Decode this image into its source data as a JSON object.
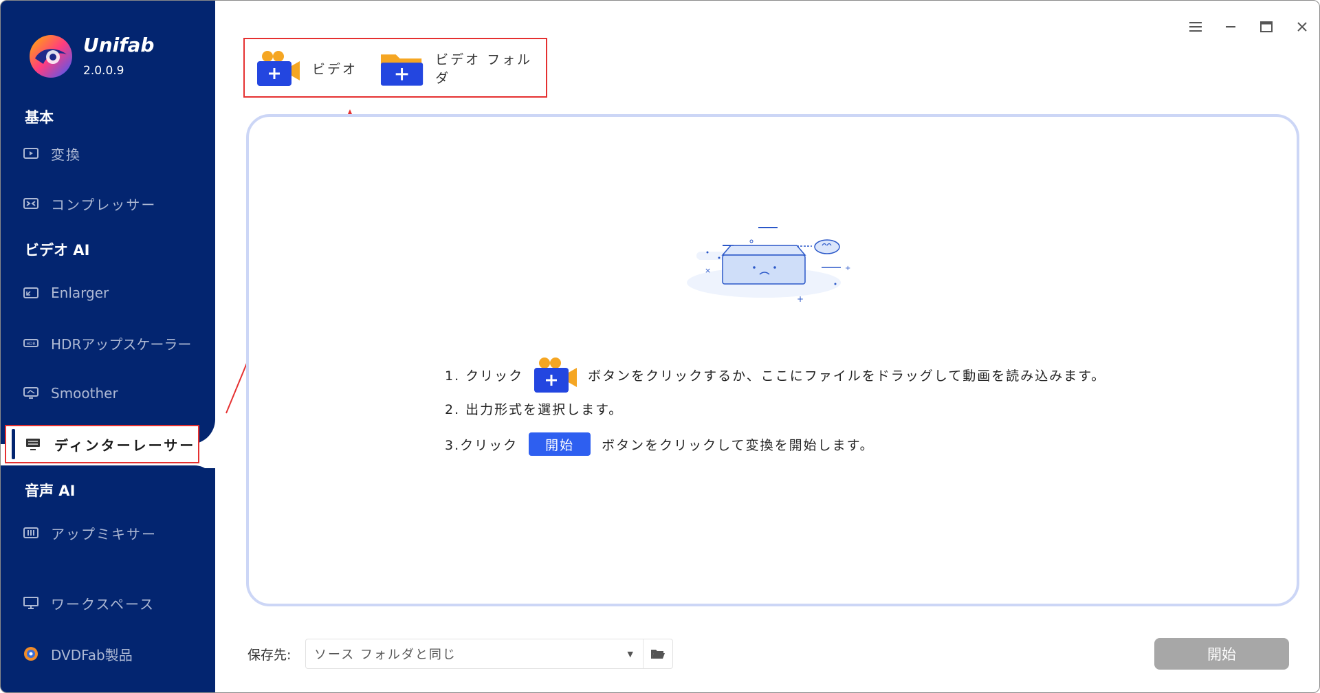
{
  "app": {
    "name": "Unifab",
    "version": "2.0.0.9"
  },
  "sidebar": {
    "sections": {
      "basic": "基本",
      "video_ai": "ビデオ AI",
      "audio_ai": "音声 AI"
    },
    "items": [
      {
        "label": "変換",
        "icon": "play-box-icon"
      },
      {
        "label": "コンプレッサー",
        "icon": "compress-icon"
      },
      {
        "label": "Enlarger",
        "icon": "enlarge-icon"
      },
      {
        "label": "HDRアップスケーラー",
        "icon": "hdr-icon"
      },
      {
        "label": "Smoother",
        "icon": "smoother-icon"
      },
      {
        "label": "ディンターレーサー",
        "icon": "deinterlacer-icon",
        "active": true
      },
      {
        "label": "アップミキサー",
        "icon": "upmixer-icon"
      },
      {
        "label": "ワークスペース",
        "icon": "monitor-icon"
      },
      {
        "label": "DVDFab製品",
        "icon": "dvdfab-icon"
      }
    ]
  },
  "toolbar": {
    "add_video": "ビデオ",
    "add_folder": "ビデオ フォルダ"
  },
  "instructions": {
    "step1_a": "1. クリック",
    "step1_b": "ボタンをクリックするか、ここにファイルをドラッグして動画を読み込みます。",
    "step2": "2. 出力形式を選択します。",
    "step3_a": "3.クリック",
    "step3_btn": "開始",
    "step3_b": "ボタンをクリックして変換を開始します。"
  },
  "footer": {
    "save_label": "保存先:",
    "save_value": "ソース フォルダと同じ",
    "start_label": "開始"
  },
  "colors": {
    "sidebar": "#032570",
    "accent": "#2e5ff0",
    "highlight_border": "#e53030",
    "disabled_button": "#a7a7a7"
  }
}
